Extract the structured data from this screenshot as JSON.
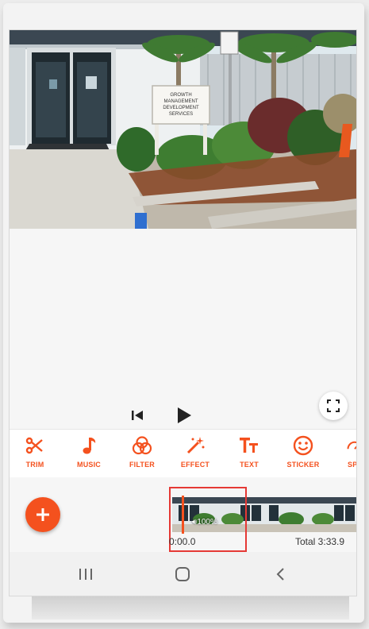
{
  "player": {
    "prev_icon": "skip-previous-icon",
    "play_icon": "play-icon",
    "fullscreen_icon": "fullscreen-icon",
    "sign_text": [
      "GROWTH",
      "MANAGEMENT",
      "DEVELOPMENT",
      "SERVICES"
    ]
  },
  "toolbar": {
    "items": [
      {
        "label": "TRIM",
        "icon": "scissors-icon"
      },
      {
        "label": "MUSIC",
        "icon": "music-note-icon"
      },
      {
        "label": "FILTER",
        "icon": "filter-circles-icon"
      },
      {
        "label": "EFFECT",
        "icon": "magic-wand-icon"
      },
      {
        "label": "TEXT",
        "icon": "text-icon"
      },
      {
        "label": "STICKER",
        "icon": "smiley-icon"
      },
      {
        "label": "SPE",
        "icon": "speed-icon"
      }
    ],
    "accent": "#f4511e"
  },
  "timeline": {
    "add_icon": "plus-icon",
    "clip_volume": "100%",
    "current_time": "0:00.0",
    "total_time": "Total 3:33.9"
  },
  "navbar": {
    "recents_icon": "recents-icon",
    "home_icon": "home-icon",
    "back_icon": "back-icon"
  }
}
